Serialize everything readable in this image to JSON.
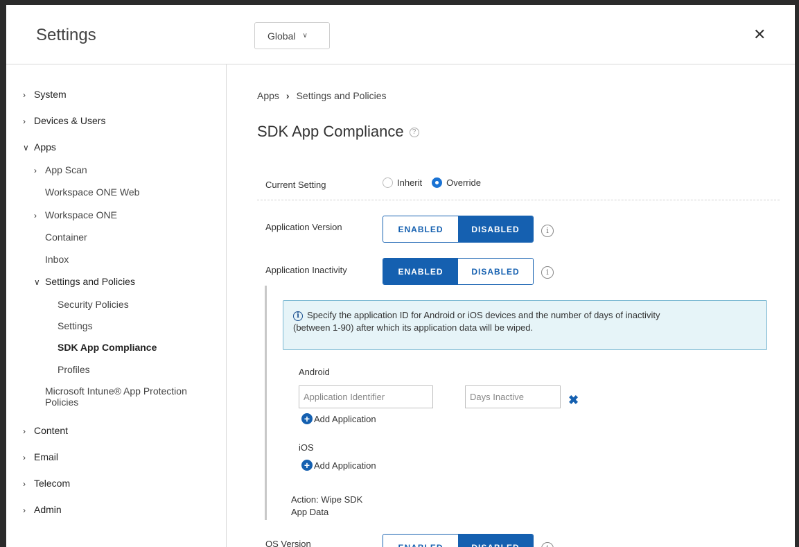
{
  "header": {
    "title": "Settings",
    "scope_value": "Global",
    "close_label": "✕"
  },
  "sidebar": {
    "items": [
      {
        "label": "System"
      },
      {
        "label": "Devices & Users"
      },
      {
        "label": "Apps"
      },
      {
        "label": "App Scan"
      },
      {
        "label": "Workspace ONE Web"
      },
      {
        "label": "Workspace ONE"
      },
      {
        "label": "Container"
      },
      {
        "label": "Inbox"
      },
      {
        "label": "Settings and Policies"
      },
      {
        "label": "Security Policies"
      },
      {
        "label": "Settings"
      },
      {
        "label": "SDK App Compliance"
      },
      {
        "label": "Profiles"
      },
      {
        "label": "Microsoft Intune® App Protection"
      },
      {
        "label": "Policies"
      },
      {
        "label": "Content"
      },
      {
        "label": "Email"
      },
      {
        "label": "Telecom"
      },
      {
        "label": "Admin"
      }
    ]
  },
  "breadcrumb": {
    "parent": "Apps",
    "separator": "›",
    "current": "Settings and Policies"
  },
  "page": {
    "title": "SDK App Compliance",
    "help_icon": "?"
  },
  "current_setting": {
    "label": "Current Setting",
    "options": [
      "Inherit",
      "Override"
    ],
    "selected": "Override"
  },
  "toggle_options": {
    "enabled": "ENABLED",
    "disabled": "DISABLED"
  },
  "application_version": {
    "label": "Application Version",
    "value": "DISABLED"
  },
  "application_inactivity": {
    "label": "Application Inactivity",
    "value": "ENABLED",
    "notice_line1": "Specify the application ID for Android or iOS devices and the number of days of inactivity",
    "notice_line2": "(between 1-90) after which its application data will be wiped.",
    "android_label": "Android",
    "app_id_placeholder": "Application Identifier",
    "days_placeholder": "Days Inactive",
    "add_label": "Add Application",
    "ios_label": "iOS",
    "action_line1": "Action: Wipe SDK",
    "action_line2": "App Data"
  },
  "os_version": {
    "label": "OS Version",
    "value": "DISABLED"
  },
  "info_glyph": "i",
  "colors": {
    "accent": "#1560b0",
    "notice_bg": "#e6f4f8",
    "notice_border": "#79b7d1"
  }
}
